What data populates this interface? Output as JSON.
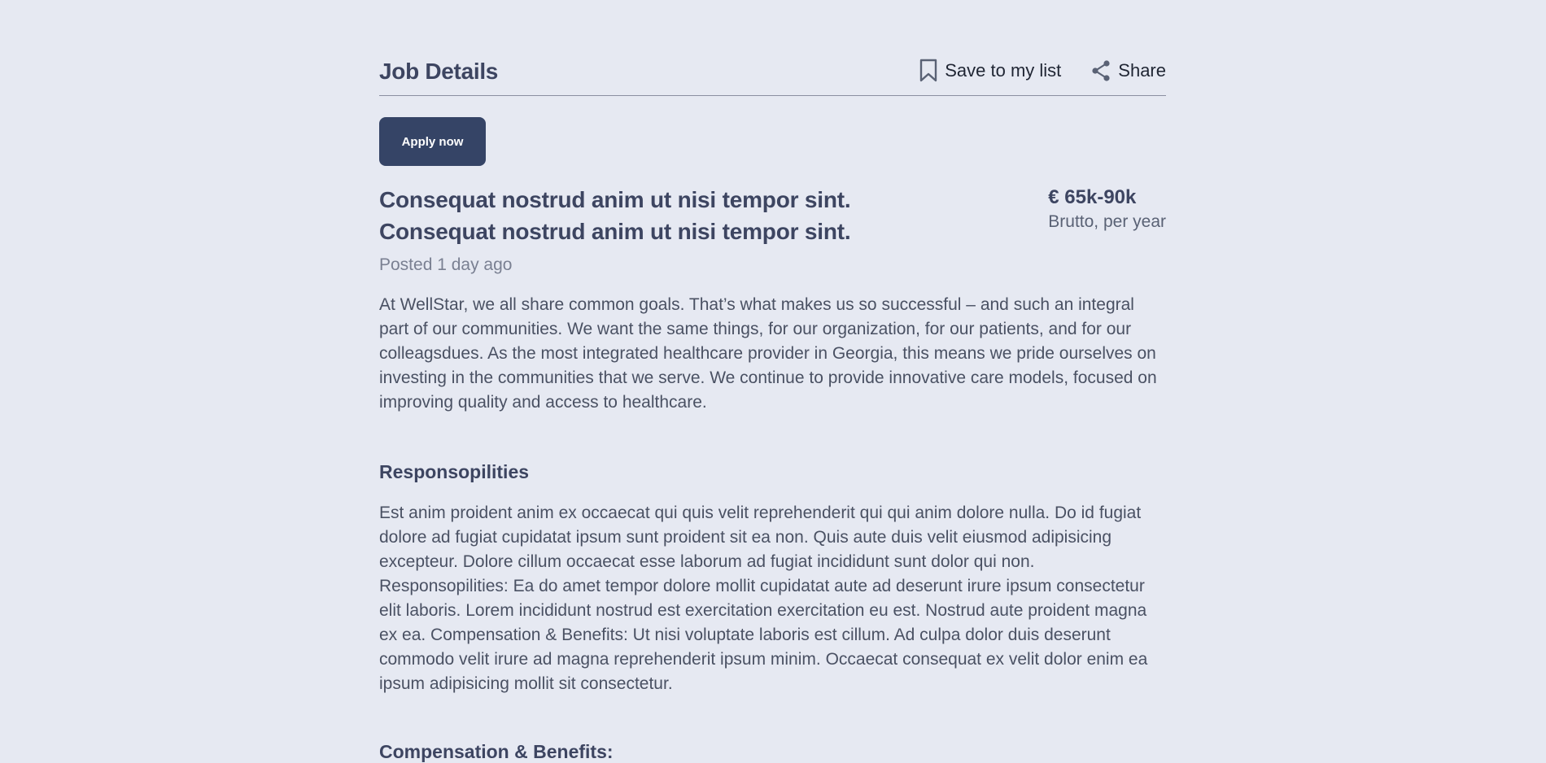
{
  "header": {
    "title": "Job Details",
    "save_label": "Save to my list",
    "share_label": "Share",
    "save_icon": "bookmark-icon",
    "share_icon": "share-icon"
  },
  "apply_button": "Apply now",
  "job": {
    "title_line1": "Consequat nostrud anim ut nisi tempor sint.",
    "title_line2": "Consequat nostrud anim ut nisi tempor sint.",
    "posted": "Posted 1 day ago",
    "salary": "€ 65k-90k",
    "salary_period": "Brutto, per year",
    "intro": "At WellStar, we all share common goals. That’s what makes us so successful – and such an integral part of our communities. We want the same things, for our organization, for our patients, and for our colleagsdues. As the most integrated healthcare provider in Georgia, this means we pride ourselves on investing in the communities that we serve. We continue to provide innovative care models, focused on improving quality and access to healthcare."
  },
  "sections": {
    "responsibilities_title": "Responsopilities",
    "responsibilities_body": "Est anim proident anim ex occaecat qui quis velit reprehenderit qui qui anim dolore nulla. Do id fugiat dolore ad fugiat cupidatat ipsum sunt proident sit ea non. Quis aute duis velit eiusmod adipisicing excepteur. Dolore cillum occaecat esse laborum ad fugiat incididunt sunt dolor qui non. Responsopilities: Ea do amet tempor dolore mollit cupidatat aute ad deserunt irure ipsum consectetur elit laboris. Lorem incididunt nostrud est exercitation exercitation eu est. Nostrud aute proident magna ex ea. Compensation & Benefits: Ut nisi voluptate laboris est cillum. Ad culpa dolor duis deserunt commodo velit irure ad magna reprehenderit ipsum minim. Occaecat consequat ex velit dolor enim ea ipsum adipisicing mollit sit consectetur.",
    "compensation_title": "Compensation & Benefits:"
  },
  "colors": {
    "background": "#e6e9f2",
    "primary_button": "#354466",
    "heading": "#3d4561",
    "body_text": "#4a5163",
    "muted_text": "#7a8092"
  }
}
